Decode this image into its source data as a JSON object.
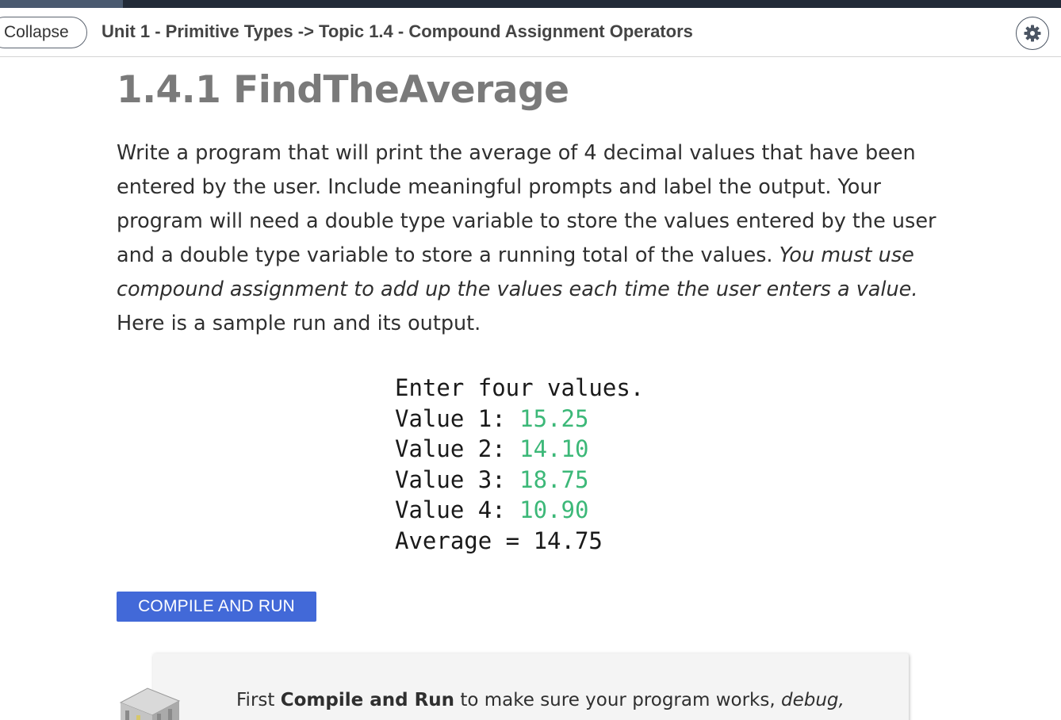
{
  "header": {
    "collapse_label": "Collapse",
    "breadcrumb": "Unit 1 - Primitive Types -> Topic 1.4 - Compound Assignment Operators",
    "settings_icon": "gear-icon"
  },
  "page": {
    "title": "1.4.1 FindTheAverage"
  },
  "description": {
    "text_before_emphasis": "Write a program that will print the average of 4 decimal values that have been entered by the user. Include meaningful prompts and label the output. Your program will need a double type variable to store the values entered by the user and a double type variable to store a running total of the values. ",
    "emphasis": "You must use compound assignment to add up the values each time the user enters a value.",
    "text_after_emphasis": " Here is a sample run and its output."
  },
  "sample_run": {
    "prompt": "Enter four values.",
    "values": [
      {
        "label": "Value 1: ",
        "input": "15.25"
      },
      {
        "label": "Value 2: ",
        "input": "14.10"
      },
      {
        "label": "Value 3: ",
        "input": "18.75"
      },
      {
        "label": "Value 4: ",
        "input": "10.90"
      }
    ],
    "result": "Average = 14.75"
  },
  "actions": {
    "compile_label": "COMPILE AND RUN"
  },
  "info": {
    "text_start": "First ",
    "bold": "Compile and Run",
    "text_middle": " to make sure your program works, ",
    "italic": "debug,"
  },
  "colors": {
    "topbar": "#222b38",
    "accent_blue": "#4269d8",
    "input_green": "#3cb878",
    "title_gray": "#7a7a7a"
  }
}
